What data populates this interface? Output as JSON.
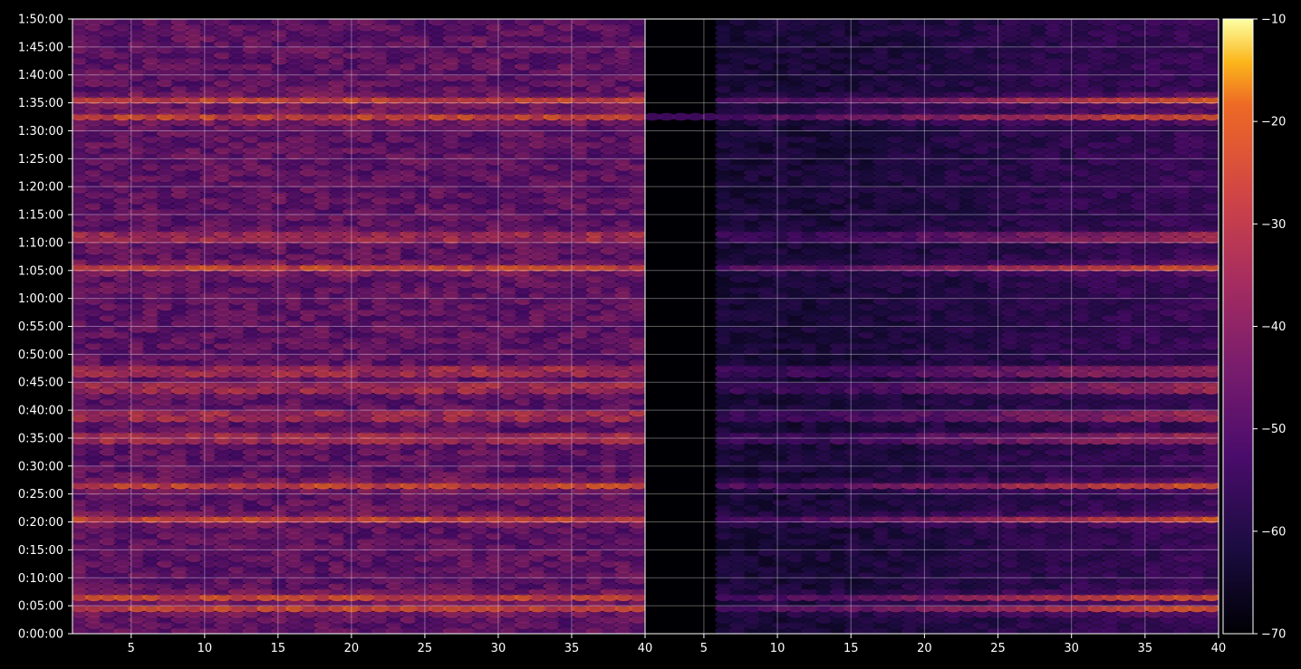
{
  "chart_data": {
    "type": "heatmap",
    "layout_note_free": true,
    "panels": [
      {
        "name": "",
        "x_ticks": [
          5,
          10,
          15,
          20,
          25,
          30,
          35,
          40
        ],
        "x_range": [
          1,
          40
        ]
      },
      {
        "name": "",
        "x_ticks": [
          5,
          10,
          15,
          20,
          25,
          30,
          35,
          40
        ],
        "x_range": [
          1,
          40
        ]
      }
    ],
    "y_ticks": [
      "0:00:00",
      "0:05:00",
      "0:10:00",
      "0:15:00",
      "0:20:00",
      "0:25:00",
      "0:30:00",
      "0:35:00",
      "0:40:00",
      "0:45:00",
      "0:50:00",
      "0:55:00",
      "1:00:00",
      "1:05:00",
      "1:10:00",
      "1:15:00",
      "1:20:00",
      "1:25:00",
      "1:30:00",
      "1:35:00",
      "1:40:00",
      "1:45:00",
      "1:50:00"
    ],
    "y_range_minutes": [
      0,
      110
    ],
    "colorbar": {
      "ticks": [
        "−10",
        "−20",
        "−30",
        "−40",
        "−50",
        "−60",
        "−70"
      ],
      "range": [
        -70,
        -10
      ],
      "colormap": "inferno"
    },
    "strong_bands_minutes": [
      4,
      6,
      20,
      26,
      34.5,
      38.5,
      43.5,
      46.5,
      65,
      70.5,
      92,
      95
    ],
    "grid": true,
    "xlabel": "",
    "ylabel": "",
    "title": ""
  }
}
